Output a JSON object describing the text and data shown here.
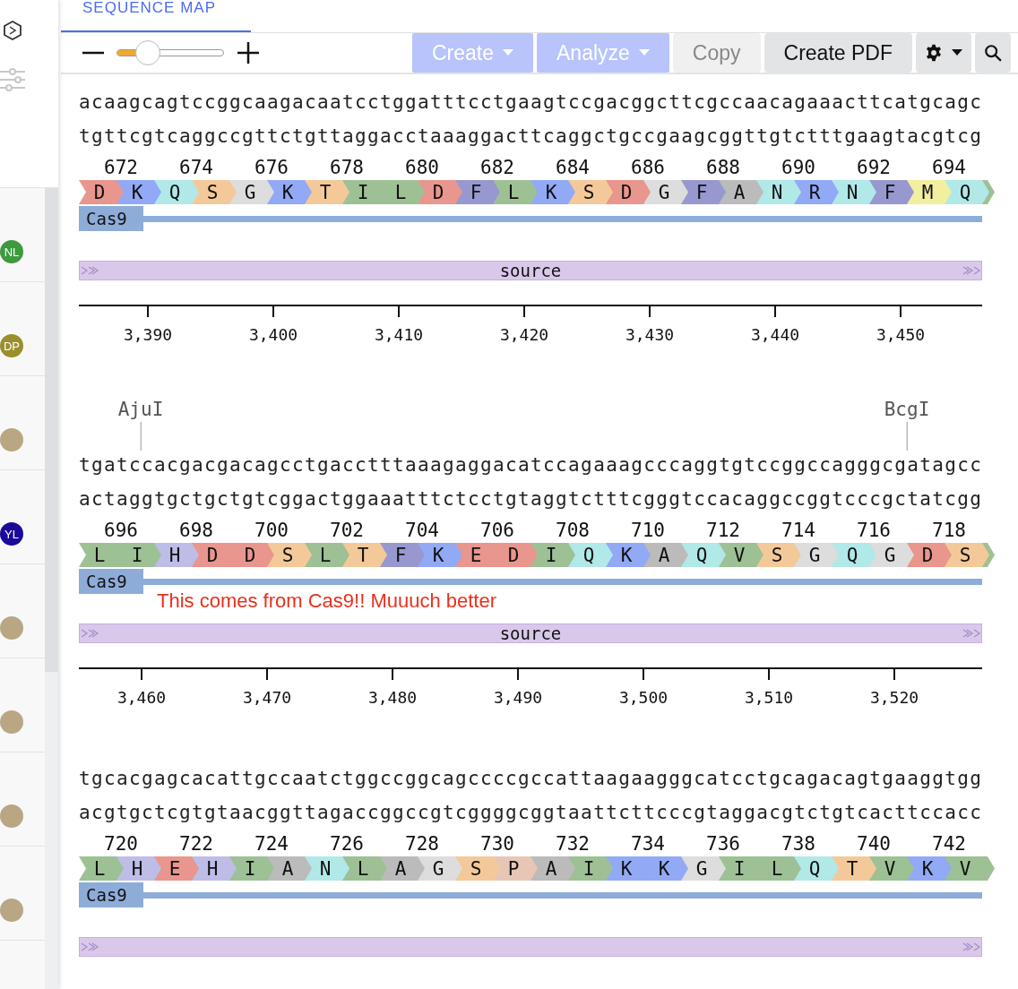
{
  "tab": {
    "label": "SEQUENCE MAP",
    "selected": true
  },
  "zoom": {
    "level": 0.28
  },
  "toolbar": [
    {
      "label": "Create",
      "kind": "dropdown",
      "disabled": false
    },
    {
      "label": "Analyze",
      "kind": "dropdown",
      "disabled": false
    },
    {
      "label": "Copy",
      "kind": "plain",
      "disabled": true
    },
    {
      "label": "Create PDF",
      "kind": "plain",
      "disabled": false
    }
  ],
  "collaborators": [
    {
      "kind": "initials",
      "initials": "NL",
      "color": "#3e9a3e"
    },
    {
      "kind": "initials",
      "initials": "DP",
      "color": "#9a8f2b"
    },
    {
      "kind": "photo"
    },
    {
      "kind": "initials",
      "initials": "YL",
      "color": "#1a0a9a"
    },
    {
      "kind": "photo"
    },
    {
      "kind": "photo"
    },
    {
      "kind": "photo"
    },
    {
      "kind": "photo"
    }
  ],
  "rows": [
    {
      "enzymes": [],
      "top": "acaagcagtccggcaagacaatcctggatttcctgaagtccgacggcttcgccaacagaaacttcatgcagc",
      "bottom": "tgttcgtcaggccgttctgttaggacctaaaggacttcaggctgccgaagcggttgtctttgaagtacgtcg",
      "numbers": [
        "672",
        "674",
        "676",
        "678",
        "680",
        "682",
        "684",
        "686",
        "688",
        "690",
        "692",
        "694"
      ],
      "aminos": [
        {
          "letter": "D",
          "color": "#e8968e"
        },
        {
          "letter": "K",
          "color": "#92a9f6"
        },
        {
          "letter": "Q",
          "color": "#b1e8e8"
        },
        {
          "letter": "S",
          "color": "#f4c999"
        },
        {
          "letter": "G",
          "color": "#dddddd"
        },
        {
          "letter": "K",
          "color": "#92a9f6"
        },
        {
          "letter": "T",
          "color": "#f4c999"
        },
        {
          "letter": "I",
          "color": "#9dc195"
        },
        {
          "letter": "L",
          "color": "#9dc195"
        },
        {
          "letter": "D",
          "color": "#e8968e"
        },
        {
          "letter": "F",
          "color": "#9898d0"
        },
        {
          "letter": "L",
          "color": "#9dc195"
        },
        {
          "letter": "K",
          "color": "#92a9f6"
        },
        {
          "letter": "S",
          "color": "#f4c999"
        },
        {
          "letter": "D",
          "color": "#e8968e"
        },
        {
          "letter": "G",
          "color": "#dddddd"
        },
        {
          "letter": "F",
          "color": "#9898d0"
        },
        {
          "letter": "A",
          "color": "#bbbbbb"
        },
        {
          "letter": "N",
          "color": "#b1e8e8"
        },
        {
          "letter": "R",
          "color": "#92a9f6"
        },
        {
          "letter": "N",
          "color": "#b1e8e8"
        },
        {
          "letter": "F",
          "color": "#9898d0"
        },
        {
          "letter": "M",
          "color": "#f2ef9f"
        },
        {
          "letter": "Q",
          "color": "#b1e8e8"
        }
      ],
      "feature": {
        "label": "Cas9"
      },
      "source": {
        "label": "source"
      },
      "ticks": [
        "3,390",
        "3,400",
        "3,410",
        "3,420",
        "3,430",
        "3,440",
        "3,450"
      ]
    },
    {
      "enzymes": [
        {
          "name": "AjuI"
        },
        {
          "name": "BcgI"
        }
      ],
      "top": "tgatccacgacgacagcctgacctttaaagaggacatccagaaagcccaggtgtccggccagggcgatagcc",
      "bottom": "actaggtgctgctgtcggactggaaatttctcctgtaggtctttcgggtccacaggccggtcccgctatcgg",
      "numbers": [
        "696",
        "698",
        "700",
        "702",
        "704",
        "706",
        "708",
        "710",
        "712",
        "714",
        "716",
        "718"
      ],
      "aminos": [
        {
          "letter": "L",
          "color": "#9dc195"
        },
        {
          "letter": "I",
          "color": "#9dc195"
        },
        {
          "letter": "H",
          "color": "#bdbde7"
        },
        {
          "letter": "D",
          "color": "#e8968e"
        },
        {
          "letter": "D",
          "color": "#e8968e"
        },
        {
          "letter": "S",
          "color": "#f4c999"
        },
        {
          "letter": "L",
          "color": "#9dc195"
        },
        {
          "letter": "T",
          "color": "#f4c999"
        },
        {
          "letter": "F",
          "color": "#9898d0"
        },
        {
          "letter": "K",
          "color": "#92a9f6"
        },
        {
          "letter": "E",
          "color": "#e8968e"
        },
        {
          "letter": "D",
          "color": "#e8968e"
        },
        {
          "letter": "I",
          "color": "#9dc195"
        },
        {
          "letter": "Q",
          "color": "#b1e8e8"
        },
        {
          "letter": "K",
          "color": "#92a9f6"
        },
        {
          "letter": "A",
          "color": "#bbbbbb"
        },
        {
          "letter": "Q",
          "color": "#b1e8e8"
        },
        {
          "letter": "V",
          "color": "#9dc195"
        },
        {
          "letter": "S",
          "color": "#f4c999"
        },
        {
          "letter": "G",
          "color": "#dddddd"
        },
        {
          "letter": "Q",
          "color": "#b1e8e8"
        },
        {
          "letter": "G",
          "color": "#dddddd"
        },
        {
          "letter": "D",
          "color": "#e8968e"
        },
        {
          "letter": "S",
          "color": "#f4c999"
        }
      ],
      "feature": {
        "label": "Cas9",
        "note": "This comes from Cas9!! Muuuch better"
      },
      "source": {
        "label": "source"
      },
      "ticks": [
        "3,460",
        "3,470",
        "3,480",
        "3,490",
        "3,500",
        "3,510",
        "3,520"
      ]
    },
    {
      "enzymes": [],
      "top": "tgcacgagcacattgccaatctggccggcagccccgccattaagaagggcatcctgcagacagtgaaggtgg",
      "bottom": "acgtgctcgtgtaacggttagaccggccgtcggggcggtaattcttcccgtaggacgtctgtcacttccacc",
      "numbers": [
        "720",
        "722",
        "724",
        "726",
        "728",
        "730",
        "732",
        "734",
        "736",
        "738",
        "740",
        "742"
      ],
      "aminos": [
        {
          "letter": "L",
          "color": "#9dc195"
        },
        {
          "letter": "H",
          "color": "#bdbde7"
        },
        {
          "letter": "E",
          "color": "#e8968e"
        },
        {
          "letter": "H",
          "color": "#bdbde7"
        },
        {
          "letter": "I",
          "color": "#9dc195"
        },
        {
          "letter": "A",
          "color": "#bbbbbb"
        },
        {
          "letter": "N",
          "color": "#b1e8e8"
        },
        {
          "letter": "L",
          "color": "#9dc195"
        },
        {
          "letter": "A",
          "color": "#bbbbbb"
        },
        {
          "letter": "G",
          "color": "#dddddd"
        },
        {
          "letter": "S",
          "color": "#f4c999"
        },
        {
          "letter": "P",
          "color": "#e8c6b6"
        },
        {
          "letter": "A",
          "color": "#bbbbbb"
        },
        {
          "letter": "I",
          "color": "#9dc195"
        },
        {
          "letter": "K",
          "color": "#92a9f6"
        },
        {
          "letter": "K",
          "color": "#92a9f6"
        },
        {
          "letter": "G",
          "color": "#dddddd"
        },
        {
          "letter": "I",
          "color": "#9dc195"
        },
        {
          "letter": "L",
          "color": "#9dc195"
        },
        {
          "letter": "Q",
          "color": "#b1e8e8"
        },
        {
          "letter": "T",
          "color": "#f4c999"
        },
        {
          "letter": "V",
          "color": "#9dc195"
        },
        {
          "letter": "K",
          "color": "#92a9f6"
        },
        {
          "letter": "V",
          "color": "#9dc195"
        }
      ],
      "feature": {
        "label": "Cas9"
      },
      "source": {},
      "ticks": []
    }
  ]
}
